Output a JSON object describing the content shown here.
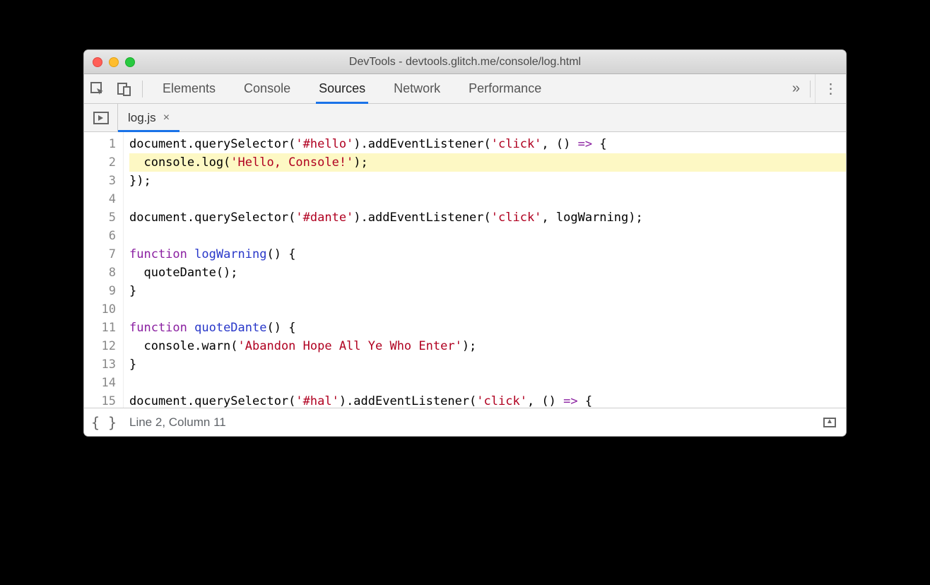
{
  "window": {
    "title": "DevTools - devtools.glitch.me/console/log.html"
  },
  "toolbar": {
    "tabs": [
      "Elements",
      "Console",
      "Sources",
      "Network",
      "Performance"
    ],
    "active_tab": "Sources",
    "overflow_glyph": "»"
  },
  "filebar": {
    "open_file": "log.js",
    "close_glyph": "×"
  },
  "editor": {
    "highlighted_line": 2,
    "lines": [
      {
        "n": 1,
        "tokens": [
          [
            "",
            "document.querySelector("
          ],
          [
            "str",
            "'#hello'"
          ],
          [
            "",
            ").addEventListener("
          ],
          [
            "str",
            "'click'"
          ],
          [
            "",
            ", () "
          ],
          [
            "op",
            "=>"
          ],
          [
            "",
            " {"
          ]
        ]
      },
      {
        "n": 2,
        "tokens": [
          [
            "",
            "  console.log("
          ],
          [
            "str",
            "'Hello, Console!'"
          ],
          [
            "",
            ");"
          ]
        ]
      },
      {
        "n": 3,
        "tokens": [
          [
            "",
            "});"
          ]
        ]
      },
      {
        "n": 4,
        "tokens": [
          [
            "",
            ""
          ]
        ]
      },
      {
        "n": 5,
        "tokens": [
          [
            "",
            "document.querySelector("
          ],
          [
            "str",
            "'#dante'"
          ],
          [
            "",
            ").addEventListener("
          ],
          [
            "str",
            "'click'"
          ],
          [
            "",
            ", logWarning);"
          ]
        ]
      },
      {
        "n": 6,
        "tokens": [
          [
            "",
            ""
          ]
        ]
      },
      {
        "n": 7,
        "tokens": [
          [
            "kw",
            "function "
          ],
          [
            "def",
            "logWarning"
          ],
          [
            "",
            "() {"
          ]
        ]
      },
      {
        "n": 8,
        "tokens": [
          [
            "",
            "  quoteDante();"
          ]
        ]
      },
      {
        "n": 9,
        "tokens": [
          [
            "",
            "}"
          ]
        ]
      },
      {
        "n": 10,
        "tokens": [
          [
            "",
            ""
          ]
        ]
      },
      {
        "n": 11,
        "tokens": [
          [
            "kw",
            "function "
          ],
          [
            "def",
            "quoteDante"
          ],
          [
            "",
            "() {"
          ]
        ]
      },
      {
        "n": 12,
        "tokens": [
          [
            "",
            "  console.warn("
          ],
          [
            "str",
            "'Abandon Hope All Ye Who Enter'"
          ],
          [
            "",
            ");"
          ]
        ]
      },
      {
        "n": 13,
        "tokens": [
          [
            "",
            "}"
          ]
        ]
      },
      {
        "n": 14,
        "tokens": [
          [
            "",
            ""
          ]
        ]
      },
      {
        "n": 15,
        "tokens": [
          [
            "",
            "document.querySelector("
          ],
          [
            "str",
            "'#hal'"
          ],
          [
            "",
            ").addEventListener("
          ],
          [
            "str",
            "'click'"
          ],
          [
            "",
            ", () "
          ],
          [
            "op",
            "=>"
          ],
          [
            "",
            " {"
          ]
        ]
      }
    ]
  },
  "status": {
    "braces": "{ }",
    "position": "Line 2, Column 11"
  }
}
